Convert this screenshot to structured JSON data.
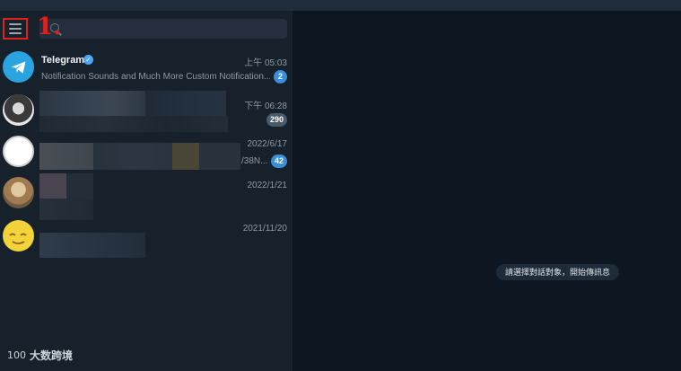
{
  "sidebar": {
    "step_label": "1.",
    "search_placeholder": "",
    "chats": [
      {
        "name": "Telegram",
        "preview": "Notification Sounds and Much More  Custom Notification...",
        "time": "上午 05:03",
        "unread": "2",
        "badge_style": "blue"
      },
      {
        "name": "",
        "preview": "",
        "time": "下午 06:28",
        "unread": "290",
        "badge_style": "gray"
      },
      {
        "name": "",
        "preview": "/38N...",
        "time": "2022/6/17",
        "unread": "42",
        "badge_style": "blue"
      },
      {
        "name": "",
        "preview": "",
        "time": "2022/1/21",
        "unread": "",
        "badge_style": ""
      },
      {
        "name": "",
        "preview": "",
        "time": "2021/11/20",
        "unread": "",
        "badge_style": ""
      }
    ]
  },
  "chatpane": {
    "empty_hint": "請選擇對話對象，開始傳訊息"
  },
  "watermark": {
    "mark": "100",
    "text": "大数跨境"
  },
  "colors": {
    "accent_red": "#e02020",
    "badge_blue": "#3a8fd8",
    "sidebar_bg": "#17212b",
    "chat_bg": "#0e1621"
  }
}
